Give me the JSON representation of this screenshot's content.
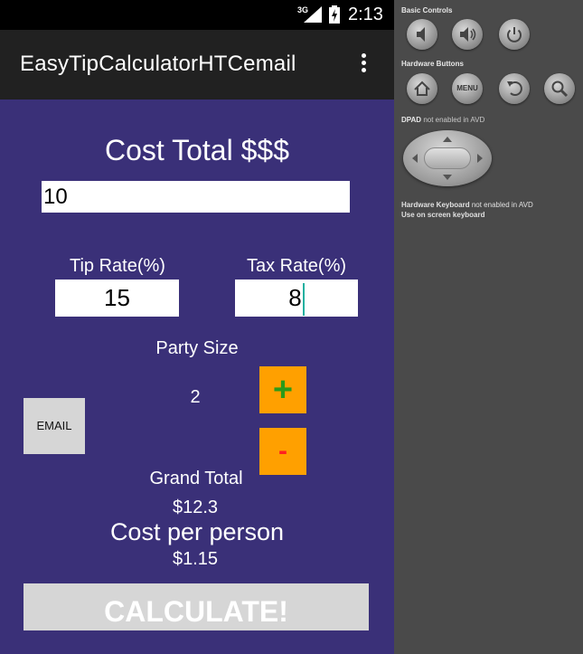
{
  "status_bar": {
    "network": "3G",
    "time": "2:13",
    "icons": [
      "signal-icon",
      "battery-icon"
    ]
  },
  "action_bar": {
    "title": "EasyTipCalculatorHTCemail",
    "overflow_icon": "more-vert-icon"
  },
  "form": {
    "cost_label": "Cost Total $$$",
    "cost_value": "10",
    "tip_label": "Tip Rate(%)",
    "tip_value": "15",
    "tax_label": "Tax Rate(%)",
    "tax_value": "8",
    "party_label": "Party Size",
    "party_value": "2",
    "plus_label": "+",
    "minus_label": "-",
    "email_label": "EMAIL",
    "grand_total_label": "Grand Total",
    "grand_total_value": "$12.3",
    "cost_per_person_label": "Cost per person",
    "cost_per_person_value": "$1.15",
    "calculate_label": "CALCULATE!"
  },
  "emulator_panel": {
    "basic_controls_label": "Basic Controls",
    "hardware_buttons_label": "Hardware Buttons",
    "menu_label": "MENU",
    "dpad_label": "DPAD",
    "dpad_note": "not enabled in AVD",
    "keyboard_label": "Hardware Keyboard",
    "keyboard_note": "not enabled in AVD",
    "keyboard_note2": "Use on screen keyboard",
    "basic_controls": [
      "volume-down-icon",
      "volume-up-icon",
      "power-icon"
    ],
    "hardware_buttons": [
      "home-icon",
      "menu-button",
      "back-icon",
      "search-icon"
    ]
  },
  "colors": {
    "app_background": "#3a3078",
    "action_bar": "#212121",
    "accent_orange": "#ffa000",
    "plus_green": "#2a9a1a",
    "minus_red": "#ff2020",
    "button_gray": "#d6d6d6"
  }
}
